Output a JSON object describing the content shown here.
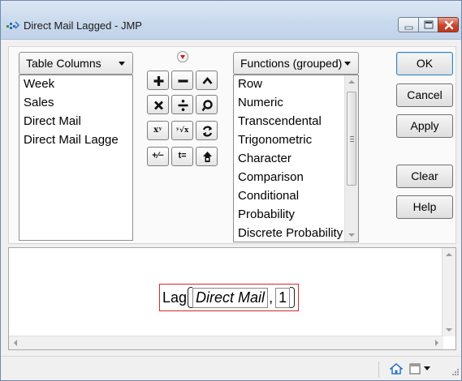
{
  "window": {
    "title": "Direct Mail Lagged - JMP"
  },
  "columns_panel": {
    "dropdown_label": "Table Columns",
    "items": [
      "Week",
      "Sales",
      "Direct Mail",
      "Direct Mail Lagge"
    ]
  },
  "operators": {
    "add": "+",
    "subtract": "−",
    "multiply": "×",
    "divide": "÷",
    "exponent": "xʸ",
    "root": "ʸ√x",
    "plus_minus": "+⁄−",
    "assign": "t="
  },
  "functions_panel": {
    "dropdown_label": "Functions (grouped)",
    "items": [
      "Row",
      "Numeric",
      "Transcendental",
      "Trigonometric",
      "Character",
      "Comparison",
      "Conditional",
      "Probability",
      "Discrete Probability"
    ]
  },
  "actions": {
    "ok": "OK",
    "cancel": "Cancel",
    "apply": "Apply",
    "clear": "Clear",
    "help": "Help"
  },
  "formula": {
    "function_name": "Lag",
    "argument_column": "Direct Mail",
    "separator": ",",
    "argument_number": "1"
  },
  "icons": {
    "app": "jmp-app-icon",
    "home": "home-icon"
  },
  "colors": {
    "accent_red": "#d22a2a",
    "title_bar": "#c8d8ec",
    "close_button": "#c9452d"
  }
}
